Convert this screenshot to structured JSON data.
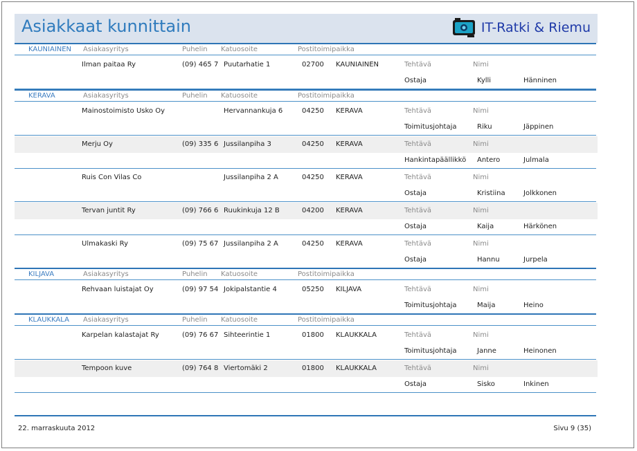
{
  "report": {
    "title": "Asiakkaat kunnittain",
    "brand": "IT-Ratki & Riemu"
  },
  "labels": {
    "company": "Asiakasyritys",
    "phone": "Puhelin",
    "street": "Katuosoite",
    "postal": "Postitoimipaikka",
    "role": "Tehtävä",
    "name": "Nimi"
  },
  "groups": [
    {
      "municipality": "KAUNIAINEN",
      "rows": [
        {
          "company": "Ilman paitaa Ry",
          "phone": "(09) 465 7",
          "street": "Puutarhatie 1",
          "zip": "02700",
          "city": "KAUNIAINEN",
          "role": "Ostaja",
          "first": "Kylli",
          "last": "Hänninen"
        }
      ]
    },
    {
      "municipality": "KERAVA",
      "rows": [
        {
          "company": "Mainostoimisto Usko Oy",
          "phone": "",
          "street": "Hervannankuja 6",
          "zip": "04250",
          "city": "KERAVA",
          "role": "Toimitusjohtaja",
          "first": "Riku",
          "last": "Jäppinen"
        },
        {
          "company": "Merju Oy",
          "phone": "(09) 335 6",
          "street": "Jussilanpiha 3",
          "zip": "04250",
          "city": "KERAVA",
          "role": "Hankintapäällikkö",
          "first": "Antero",
          "last": "Julmala"
        },
        {
          "company": "Ruis Con Vilas Co",
          "phone": "",
          "street": "Jussilanpiha 2 A",
          "zip": "04250",
          "city": "KERAVA",
          "role": "Ostaja",
          "first": "Kristiina",
          "last": "Jolkkonen"
        },
        {
          "company": "Tervan juntit Ry",
          "phone": "(09) 766 6",
          "street": "Ruukinkuja 12 B",
          "zip": "04200",
          "city": "KERAVA",
          "role": "Ostaja",
          "first": "Kaija",
          "last": "Härkönen"
        },
        {
          "company": "Ulmakaski Ry",
          "phone": "(09) 75 67",
          "street": "Jussilanpiha 2 A",
          "zip": "04250",
          "city": "KERAVA",
          "role": "Ostaja",
          "first": "Hannu",
          "last": "Jurpela"
        }
      ]
    },
    {
      "municipality": "KILJAVA",
      "rows": [
        {
          "company": "Rehvaan luistajat Oy",
          "phone": "(09) 97 54",
          "street": "Jokipalstantie 4",
          "zip": "05250",
          "city": "KILJAVA",
          "role": "Toimitusjohtaja",
          "first": "Maija",
          "last": "Heino"
        }
      ]
    },
    {
      "municipality": "KLAUKKALA",
      "rows": [
        {
          "company": "Karpelan kalastajat Ry",
          "phone": "(09) 76 67",
          "street": "Sihteerintie 1",
          "zip": "01800",
          "city": "KLAUKKALA",
          "role": "Toimitusjohtaja",
          "first": "Janne",
          "last": "Heinonen"
        },
        {
          "company": "Tempoon kuve",
          "phone": "(09) 764 8",
          "street": "Viertomäki 2",
          "zip": "01800",
          "city": "KLAUKKALA",
          "role": "Ostaja",
          "first": "Sisko",
          "last": "Inkinen"
        }
      ]
    }
  ],
  "footer": {
    "date": "22. marraskuuta 2012",
    "page": "Sivu 9 (35)"
  }
}
